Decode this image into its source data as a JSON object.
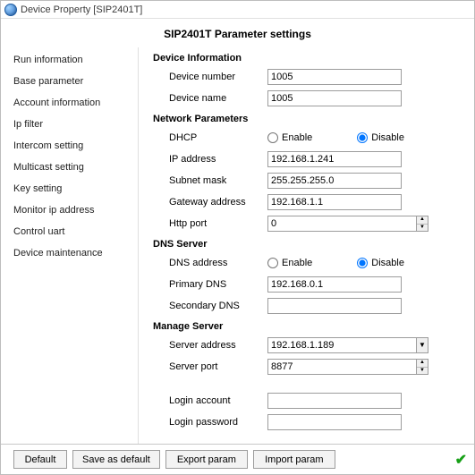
{
  "window": {
    "title": "Device Property [SIP2401T]"
  },
  "header": {
    "title": "SIP2401T Parameter settings"
  },
  "sidebar": {
    "items": [
      {
        "label": "Run information"
      },
      {
        "label": "Base parameter"
      },
      {
        "label": "Account information"
      },
      {
        "label": "Ip filter"
      },
      {
        "label": "Intercom setting"
      },
      {
        "label": "Multicast setting"
      },
      {
        "label": "Key setting"
      },
      {
        "label": "Monitor ip address"
      },
      {
        "label": "Control uart"
      },
      {
        "label": "Device maintenance"
      }
    ]
  },
  "sections": {
    "device_info": {
      "title": "Device Information",
      "device_number": {
        "label": "Device number",
        "value": "1005"
      },
      "device_name": {
        "label": "Device name",
        "value": "1005"
      }
    },
    "network": {
      "title": "Network Parameters",
      "dhcp": {
        "label": "DHCP",
        "enable": "Enable",
        "disable": "Disable",
        "value": "disable"
      },
      "ip": {
        "label": "IP address",
        "value": "192.168.1.241"
      },
      "mask": {
        "label": "Subnet mask",
        "value": "255.255.255.0"
      },
      "gateway": {
        "label": "Gateway address",
        "value": "192.168.1.1"
      },
      "http": {
        "label": "Http port",
        "value": "0"
      }
    },
    "dns": {
      "title": "DNS Server",
      "dns_addr": {
        "label": "DNS address",
        "enable": "Enable",
        "disable": "Disable",
        "value": "disable"
      },
      "primary": {
        "label": "Primary DNS",
        "value": "192.168.0.1"
      },
      "secondary": {
        "label": "Secondary DNS",
        "value": ""
      }
    },
    "manage": {
      "title": "Manage Server",
      "server_addr": {
        "label": "Server address",
        "value": "192.168.1.189"
      },
      "server_port": {
        "label": "Server port",
        "value": "8877"
      },
      "login_acct": {
        "label": "Login account",
        "value": ""
      },
      "login_pass": {
        "label": "Login password",
        "value": ""
      }
    }
  },
  "footer": {
    "default": "Default",
    "save_as_default": "Save as default",
    "export_param": "Export param",
    "import_param": "Import param"
  }
}
